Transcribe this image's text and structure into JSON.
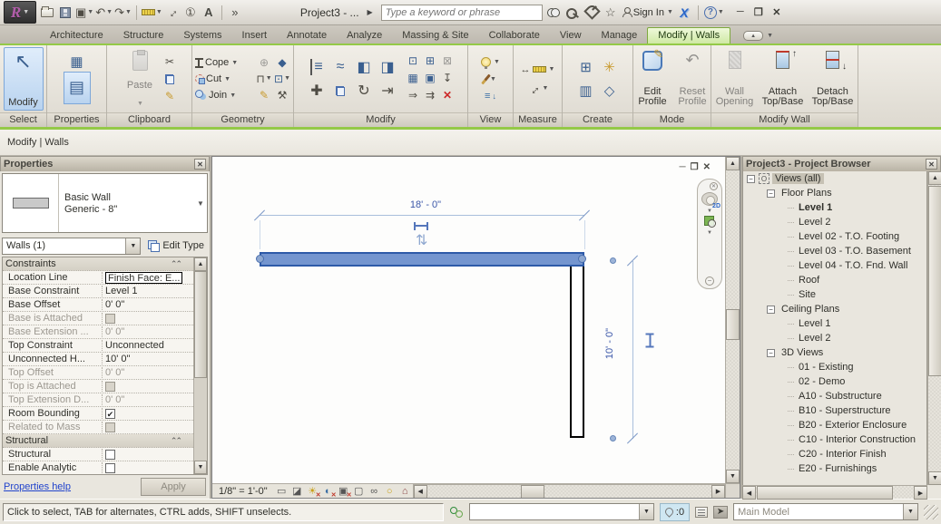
{
  "colors": {
    "contextual_green": "#94c947",
    "selection_blue": "#2d5aa8",
    "wall_fill": "#7495cf",
    "dim_blue": "#3a56a8"
  },
  "titlebar": {
    "title": "Project3 - ...",
    "search_placeholder": "Type a keyword or phrase",
    "sign_in": "Sign In"
  },
  "ribbon": {
    "tabs": [
      "Architecture",
      "Structure",
      "Systems",
      "Insert",
      "Annotate",
      "Analyze",
      "Massing & Site",
      "Collaborate",
      "View",
      "Manage"
    ],
    "active_tab": "Modify | Walls",
    "panels": {
      "select": "Select",
      "properties": "Properties",
      "clipboard": "Clipboard",
      "geometry": "Geometry",
      "modify": "Modify",
      "view": "View",
      "measure": "Measure",
      "create": "Create",
      "mode": "Mode",
      "modify_wall": "Modify Wall"
    },
    "buttons": {
      "modify": "Modify",
      "paste": "Paste",
      "cope": "Cope",
      "cut": "Cut",
      "join": "Join",
      "edit_profile": "Edit Profile",
      "reset_profile": "Reset Profile",
      "wall_opening": "Wall Opening",
      "attach": "Attach Top/Base",
      "detach": "Detach Top/Base"
    }
  },
  "modebar": {
    "text": "Modify | Walls"
  },
  "properties": {
    "title": "Properties",
    "type_name": "Basic Wall",
    "type_desc": "Generic - 8\"",
    "selector": "Walls (1)",
    "edit_type": "Edit Type",
    "rows": [
      {
        "label": "Constraints",
        "kind": "header"
      },
      {
        "label": "Location Line",
        "value": "Finish Face: E...",
        "kind": "edit"
      },
      {
        "label": "Base Constraint",
        "value": "Level 1",
        "kind": "text"
      },
      {
        "label": "Base Offset",
        "value": "0' 0\"",
        "kind": "text"
      },
      {
        "label": "Base is Attached",
        "kind": "checkoff",
        "disabled": true
      },
      {
        "label": "Base Extension ...",
        "value": "0' 0\"",
        "kind": "text",
        "disabled": true
      },
      {
        "label": "Top Constraint",
        "value": "Unconnected",
        "kind": "text"
      },
      {
        "label": "Unconnected H...",
        "value": "10' 0\"",
        "kind": "text"
      },
      {
        "label": "Top Offset",
        "value": "0' 0\"",
        "kind": "text",
        "disabled": true
      },
      {
        "label": "Top is Attached",
        "kind": "checkoff",
        "disabled": true
      },
      {
        "label": "Top Extension D...",
        "value": "0' 0\"",
        "kind": "text",
        "disabled": true
      },
      {
        "label": "Room Bounding",
        "kind": "checkon"
      },
      {
        "label": "Related to Mass",
        "kind": "checkoff",
        "disabled": true
      },
      {
        "label": "Structural",
        "kind": "header"
      },
      {
        "label": "Structural",
        "kind": "checkoff"
      },
      {
        "label": "Enable Analytic",
        "kind": "checkoff"
      }
    ],
    "help_link": "Properties help",
    "apply": "Apply"
  },
  "canvas": {
    "dim_top": "18' - 0\"",
    "dim_right": "10' - 0\"",
    "scale": "1/8\" = 1'-0\""
  },
  "browser": {
    "title": "Project3 - Project Browser",
    "tree": [
      {
        "label": "Views (all)",
        "level": 0,
        "exp": true,
        "sel": true,
        "vic": true
      },
      {
        "label": "Floor Plans",
        "level": 1,
        "exp": true
      },
      {
        "label": "Level 1",
        "level": 2,
        "bold": true
      },
      {
        "label": "Level 2",
        "level": 2
      },
      {
        "label": "Level 02 - T.O. Footing",
        "level": 2
      },
      {
        "label": "Level 03 - T.O. Basement",
        "level": 2
      },
      {
        "label": "Level 04 - T.O. Fnd. Wall",
        "level": 2
      },
      {
        "label": "Roof",
        "level": 2
      },
      {
        "label": "Site",
        "level": 2
      },
      {
        "label": "Ceiling Plans",
        "level": 1,
        "exp": true
      },
      {
        "label": "Level 1",
        "level": 2
      },
      {
        "label": "Level 2",
        "level": 2
      },
      {
        "label": "3D Views",
        "level": 1,
        "exp": true
      },
      {
        "label": "01 - Existing",
        "level": 2
      },
      {
        "label": "02 - Demo",
        "level": 2
      },
      {
        "label": "A10 - Substructure",
        "level": 2
      },
      {
        "label": "B10 - Superstructure",
        "level": 2
      },
      {
        "label": "B20 - Exterior Enclosure",
        "level": 2
      },
      {
        "label": "C10 - Interior Construction",
        "level": 2
      },
      {
        "label": "C20 - Interior Finish",
        "level": 2
      },
      {
        "label": "E20 - Furnishings",
        "level": 2
      }
    ]
  },
  "statusbar": {
    "message": "Click to select, TAB for alternates, CTRL adds, SHIFT unselects.",
    "count": ":0",
    "main_model": "Main Model"
  }
}
